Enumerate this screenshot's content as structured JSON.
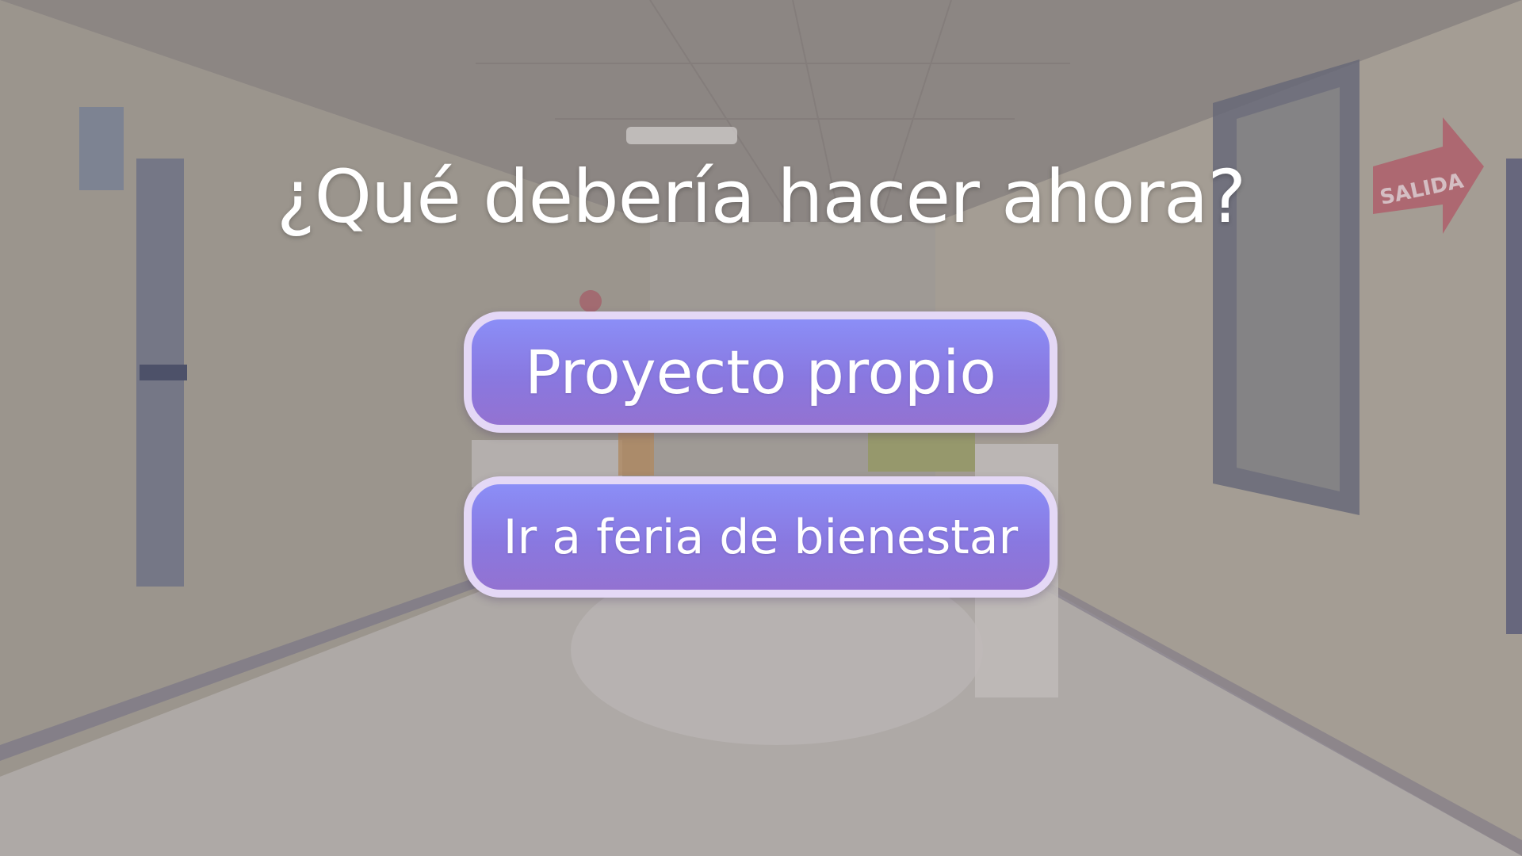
{
  "scene": {
    "question": "¿Qué debería hacer ahora?",
    "choices": [
      {
        "label": "Proyecto propio"
      },
      {
        "label": "Ir a feria de bienestar"
      }
    ],
    "sign_text": "SALIDA"
  },
  "colors": {
    "button_fill_top": "#8b8ef7",
    "button_fill_bottom": "#9372d1",
    "button_border": "#e4d8f6",
    "text": "#ffffff"
  }
}
